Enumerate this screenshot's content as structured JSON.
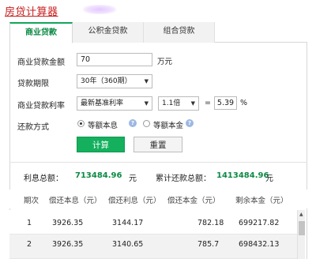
{
  "page_title": "房贷计算器",
  "tabs": [
    "商业贷款",
    "公积金贷款",
    "组合贷款"
  ],
  "form": {
    "amount_label": "商业贷款金额",
    "amount_value": "70",
    "amount_unit": "万元",
    "term_label": "贷款期限",
    "term_value": "30年（360期）",
    "rate_label": "商业贷款利率",
    "rate_type": "最新基准利率",
    "rate_multiplier": "1.1倍",
    "equals": "=",
    "rate_value": "5.39",
    "rate_unit": "%",
    "repay_label": "还款方式",
    "repay_options": [
      "等额本息",
      "等额本金"
    ],
    "repay_selected": "等额本息",
    "help_glyph": "?"
  },
  "buttons": {
    "calc": "计算",
    "reset": "重置"
  },
  "summary": {
    "interest_label": "利息总额：",
    "interest_value": "713484.96",
    "interest_unit": "元",
    "total_label": "累计还款总额：",
    "total_value": "1413484.96",
    "total_unit": "元"
  },
  "table": {
    "headers": [
      "期次",
      "偿还本息（元）",
      "偿还利息（元）",
      "偿还本金（元）",
      "剩余本金（元）"
    ],
    "rows": [
      [
        "1",
        "3926.35",
        "3144.17",
        "782.18",
        "699217.82"
      ],
      [
        "2",
        "3926.35",
        "3140.65",
        "785.7",
        "698432.13"
      ]
    ]
  },
  "icons": {
    "dropdown": "chevron-down-icon",
    "help": "question-circle-icon",
    "scroll_up": "scroll-up-arrow-icon"
  },
  "colors": {
    "accent_green": "#14b05e",
    "title_red": "#c81e1e",
    "value_green": "#0c8a44"
  }
}
